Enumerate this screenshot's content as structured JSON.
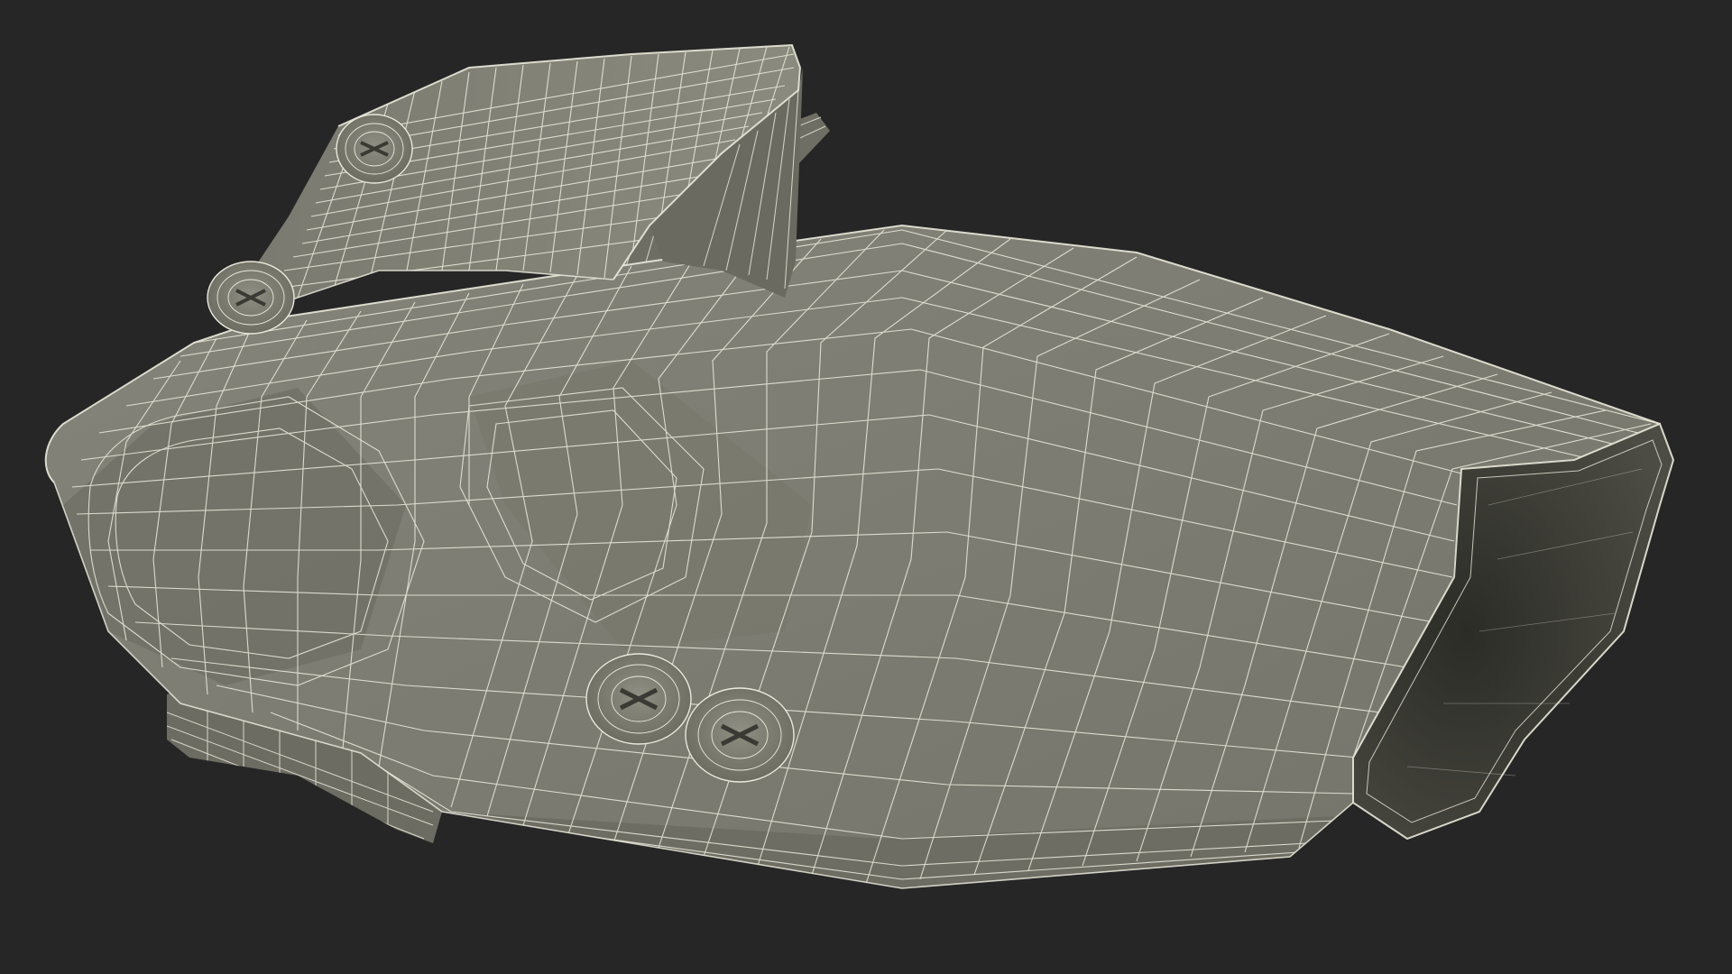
{
  "scene": {
    "subject": "holster-wireframe-render",
    "background_color": "#262626",
    "shell_color": "#7e7e72",
    "shell_dark_color": "#5c5c52",
    "shell_light_color": "#8c8c80",
    "interior_color": "#35352f",
    "wire_color": "#e9e9dc",
    "screw_count": 4
  }
}
